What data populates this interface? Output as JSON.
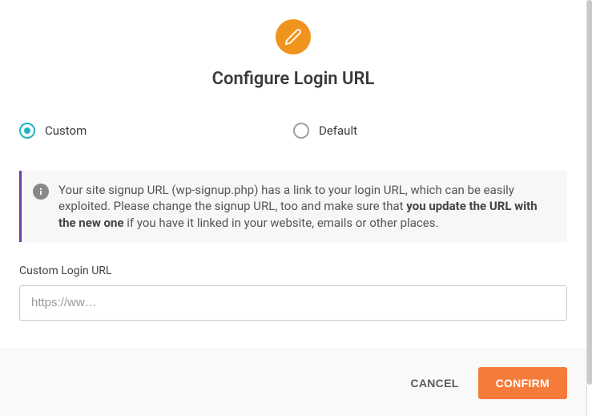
{
  "header": {
    "title": "Configure Login URL"
  },
  "options": {
    "custom_label": "Custom",
    "default_label": "Default",
    "selected": "custom"
  },
  "notice": {
    "text_plain_1": "Your site signup URL (wp-signup.php) has a link to your login URL, which can be easily exploited. Please change the signup URL, too and make sure that ",
    "text_bold": "you update the URL with the new one",
    "text_plain_2": " if you have it linked in your website, emails or other places."
  },
  "field": {
    "label": "Custom Login URL",
    "placeholder": "https://ww…",
    "value": ""
  },
  "footer": {
    "cancel_label": "CANCEL",
    "confirm_label": "CONFIRM"
  }
}
